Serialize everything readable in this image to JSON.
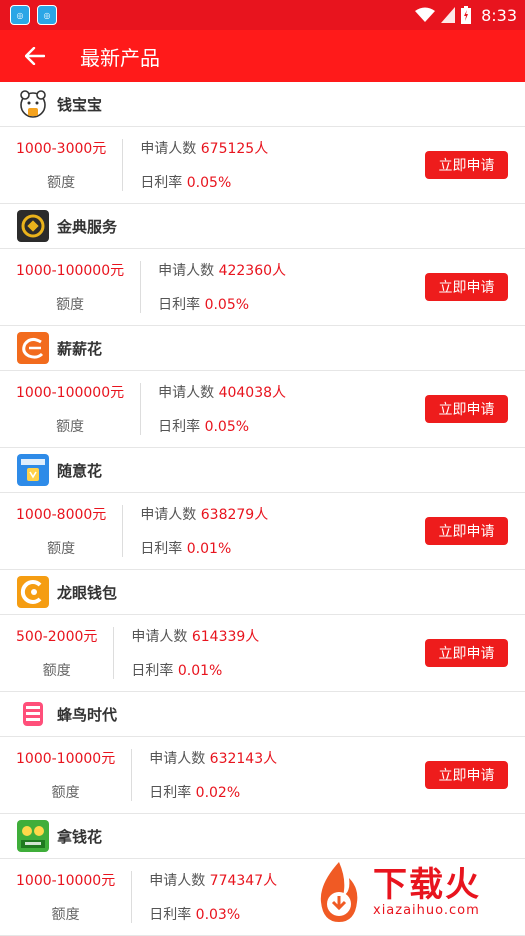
{
  "status": {
    "time": "8:33"
  },
  "appbar": {
    "title": "最新产品"
  },
  "labels": {
    "amount_label": "额度",
    "applicants_label": "申请人数",
    "rate_label": "日利率",
    "apply_button": "立即申请"
  },
  "products": [
    {
      "name": "钱宝宝",
      "amount": "1000-3000元",
      "applicants": "675125人",
      "rate": "0.05%"
    },
    {
      "name": "金典服务",
      "amount": "1000-100000元",
      "applicants": "422360人",
      "rate": "0.05%"
    },
    {
      "name": "薪薪花",
      "amount": "1000-100000元",
      "applicants": "404038人",
      "rate": "0.05%"
    },
    {
      "name": "随意花",
      "amount": "1000-8000元",
      "applicants": "638279人",
      "rate": "0.01%"
    },
    {
      "name": "龙眼钱包",
      "amount": "500-2000元",
      "applicants": "614339人",
      "rate": "0.01%"
    },
    {
      "name": "蜂鸟时代",
      "amount": "1000-10000元",
      "applicants": "632143人",
      "rate": "0.02%"
    },
    {
      "name": "拿钱花",
      "amount": "1000-10000元",
      "applicants": "774347人",
      "rate": "0.03%"
    }
  ],
  "watermark": {
    "title": "下载火",
    "url": "xiazaihuo.com"
  }
}
